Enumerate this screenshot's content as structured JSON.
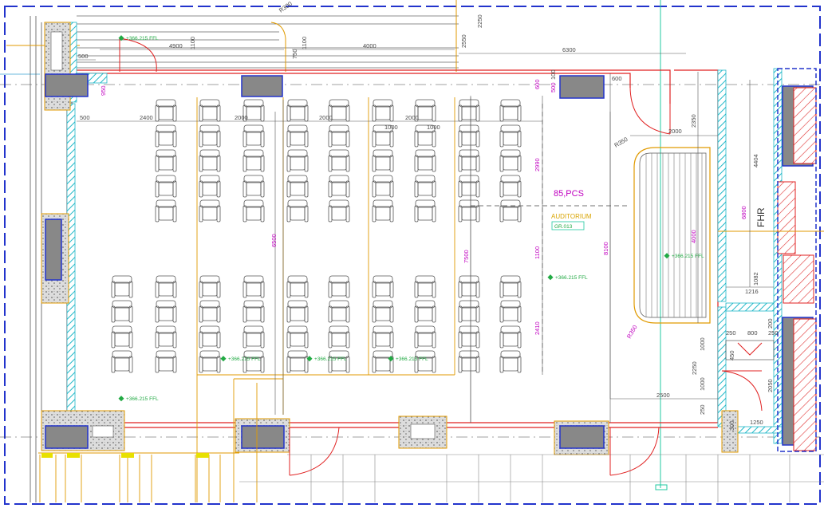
{
  "room": {
    "name": "AUDITORIUM",
    "code": "GR.013",
    "capacity": "85,PCS"
  },
  "tag": "FHR",
  "levels": {
    "l1": "+366.215 FFL",
    "l2": "+366.215 FFL",
    "l3": "+366.215 FFL",
    "l4": "+366.215 FFL",
    "l5": "+366.215 FFL",
    "l6": "+366.215 FFL",
    "l7": "+366.215 FFL",
    "l8": "+366.215 FFL"
  },
  "dims": {
    "d500a": "500",
    "d4900": "4900",
    "d1100a": "1100",
    "d750": "750",
    "d1100b": "1100",
    "d4000": "4000",
    "d2550": "2550",
    "d2250": "2250",
    "d6300": "6300",
    "d600a": "600",
    "d500b": "500",
    "d100": "100",
    "d600b": "600",
    "d950": "950",
    "d500c": "500",
    "d2400": "2400",
    "d2000a": "2000",
    "d2000b": "2000",
    "d2000c": "2000",
    "d1000a": "1000",
    "d1000b": "1000",
    "d2000d": "2000",
    "d2350": "2350",
    "r350a": "R350",
    "d2990": "2990",
    "d4404": "4404",
    "d6800": "6800",
    "d6500": "6500",
    "d7500": "7500",
    "d1100c": "1100",
    "d8100": "8100",
    "d4000b": "4000",
    "d1082": "1082",
    "d1216": "1216",
    "d2410": "2410",
    "r350b": "R350",
    "d250a": "250",
    "d800": "800",
    "d200": "200",
    "d250b": "250",
    "d1000c": "1000",
    "d450": "450",
    "d2250b": "2250",
    "d1000d": "1000",
    "d2050": "2050",
    "d2500": "2500",
    "d250c": "250",
    "d1250": "1250",
    "d300": "300",
    "r300": "R300"
  }
}
